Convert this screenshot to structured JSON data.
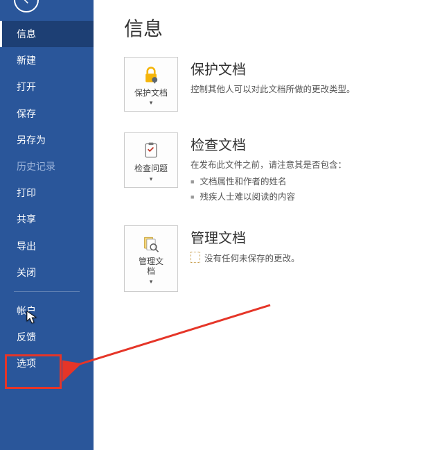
{
  "sidebar": {
    "items": [
      {
        "label": "信息",
        "selected": true,
        "disabled": false
      },
      {
        "label": "新建",
        "selected": false,
        "disabled": false
      },
      {
        "label": "打开",
        "selected": false,
        "disabled": false
      },
      {
        "label": "保存",
        "selected": false,
        "disabled": false
      },
      {
        "label": "另存为",
        "selected": false,
        "disabled": false
      },
      {
        "label": "历史记录",
        "selected": false,
        "disabled": true
      },
      {
        "label": "打印",
        "selected": false,
        "disabled": false
      },
      {
        "label": "共享",
        "selected": false,
        "disabled": false
      },
      {
        "label": "导出",
        "selected": false,
        "disabled": false
      },
      {
        "label": "关闭",
        "selected": false,
        "disabled": false
      }
    ],
    "footer": [
      {
        "label": "帐户"
      },
      {
        "label": "反馈"
      },
      {
        "label": "选项"
      }
    ]
  },
  "page": {
    "title": "信息"
  },
  "protect": {
    "button_label": "保护文档",
    "title": "保护文档",
    "desc": "控制其他人可以对此文档所做的更改类型。"
  },
  "inspect": {
    "button_label": "检查问题",
    "title": "检查文档",
    "desc": "在发布此文件之前，请注意其是否包含：",
    "bullets": [
      "文档属性和作者的姓名",
      "残疾人士难以阅读的内容"
    ]
  },
  "manage": {
    "button_label": "管理文\n档",
    "title": "管理文档",
    "desc": "没有任何未保存的更改。"
  }
}
